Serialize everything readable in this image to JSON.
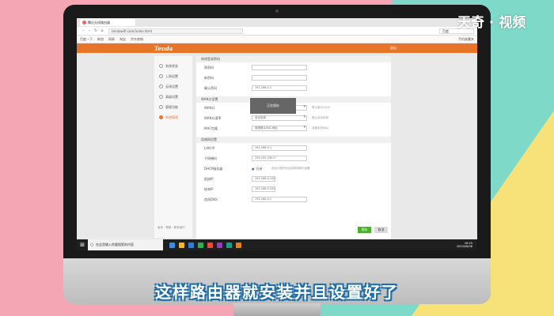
{
  "watermark": "天奇 · 视频",
  "subtitle": "这样路由器就安装并且设置好了",
  "browser": {
    "tab_title": "腾达无线路由器",
    "url": "tendawifi.com/index.html",
    "search_placeholder": "百度",
    "bookmarks": [
      "百度一下",
      "新浪",
      "网易",
      "淘宝",
      "京东商城"
    ],
    "bookmarks_right": "手机收藏夹"
  },
  "router": {
    "brand": "Tenda",
    "logout_label": "退出",
    "sidebar": [
      "系统状态",
      "上网设置",
      "无线设置",
      "高级设置",
      "管理功能",
      "系统管理"
    ],
    "sidebar_footer": "版本 · 帮助 · 联系我们",
    "overlay_text": "正在保存",
    "sections": [
      {
        "title": "修改登录密码",
        "rows": [
          {
            "label": "原密码",
            "value": "",
            "type": "field"
          },
          {
            "label": "新密码",
            "value": "",
            "type": "field"
          },
          {
            "label": "确认密码",
            "value": "192.168.0.1",
            "type": "field"
          }
        ]
      },
      {
        "title": "WAN口设置",
        "rows": [
          {
            "label": "WAN口",
            "value": "1500",
            "type": "select",
            "hint": "默认值为1500"
          },
          {
            "label": "WAN口速率",
            "value": "自动协商",
            "type": "select",
            "hint": "默认自动协商"
          },
          {
            "label": "MAC克隆",
            "value": "使用默认MAC地址",
            "type": "select",
            "hint": "克隆本机MAC"
          }
        ]
      },
      {
        "title": "局域网设置",
        "rows": [
          {
            "label": "LAN IP",
            "value": "192.168.0.1",
            "type": "field"
          },
          {
            "label": "子网掩码",
            "value": "255.255.255.0",
            "type": "field"
          },
          {
            "label": "DHCP服务器",
            "value": "开启",
            "type": "radio",
            "note": "自动分配IP地址给局域网内设备"
          },
          {
            "label": "起始IP",
            "value": "192.168.0.100",
            "type": "field"
          },
          {
            "label": "结束IP",
            "value": "192.168.0.200",
            "type": "field"
          },
          {
            "label": "首选DNS",
            "value": "192.168.0.1",
            "type": "field"
          }
        ]
      }
    ],
    "save_label": "保存",
    "cancel_label": "取消"
  },
  "taskbar": {
    "search_placeholder": "在这里输入你要搜索的内容",
    "time": "16:25",
    "date": "2020/06/08"
  },
  "colors": {
    "router_orange": "#e8742a",
    "save_green": "#4caf2a",
    "subtitle_outline": "#1d6ea8"
  }
}
